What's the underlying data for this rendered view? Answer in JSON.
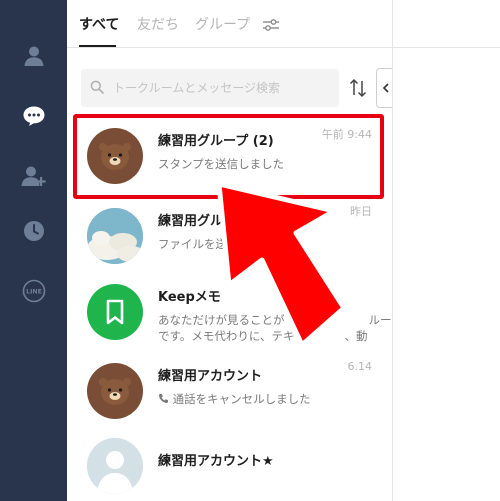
{
  "tabs": [
    {
      "label": "すべて",
      "active": true
    },
    {
      "label": "友だち",
      "active": false
    },
    {
      "label": "グループ",
      "active": false
    }
  ],
  "search": {
    "placeholder": "トークルームとメッセージ検索"
  },
  "chats": [
    {
      "name": "練習用グループ",
      "count": "(2)",
      "preview": "スタンプを送信しました",
      "time": "午前 9:44",
      "avatar": "bear-avatar"
    },
    {
      "name": "練習用グル",
      "count": "",
      "preview": "ファイルを送信",
      "time": "昨日",
      "avatar": "sky-avatar"
    },
    {
      "name": "Keepメモ",
      "count": "",
      "preview": "あなただけが見ることが",
      "preview2": "ルーム",
      "preview_line2": "です。メモ代わりに、テキ",
      "preview_line2b": "、動",
      "time": "",
      "avatar": "keep-avatar"
    },
    {
      "name": "練習用アカウント",
      "count": "",
      "preview": "通話をキャンセルしました",
      "time": "6.14",
      "avatar": "bear-avatar"
    },
    {
      "name": "練習用アカウント★",
      "count": "",
      "preview": "",
      "time": "",
      "avatar": "default-avatar"
    }
  ],
  "colors": {
    "rail": "#28354d",
    "highlight": "#e60012",
    "arrow": "#ff0000",
    "keep_green": "#20b44d",
    "bear_bg": "#7a4e36"
  },
  "rail_icons": [
    "friends-icon",
    "chat-icon",
    "add-friend-icon",
    "history-icon",
    "line-logo-icon"
  ]
}
